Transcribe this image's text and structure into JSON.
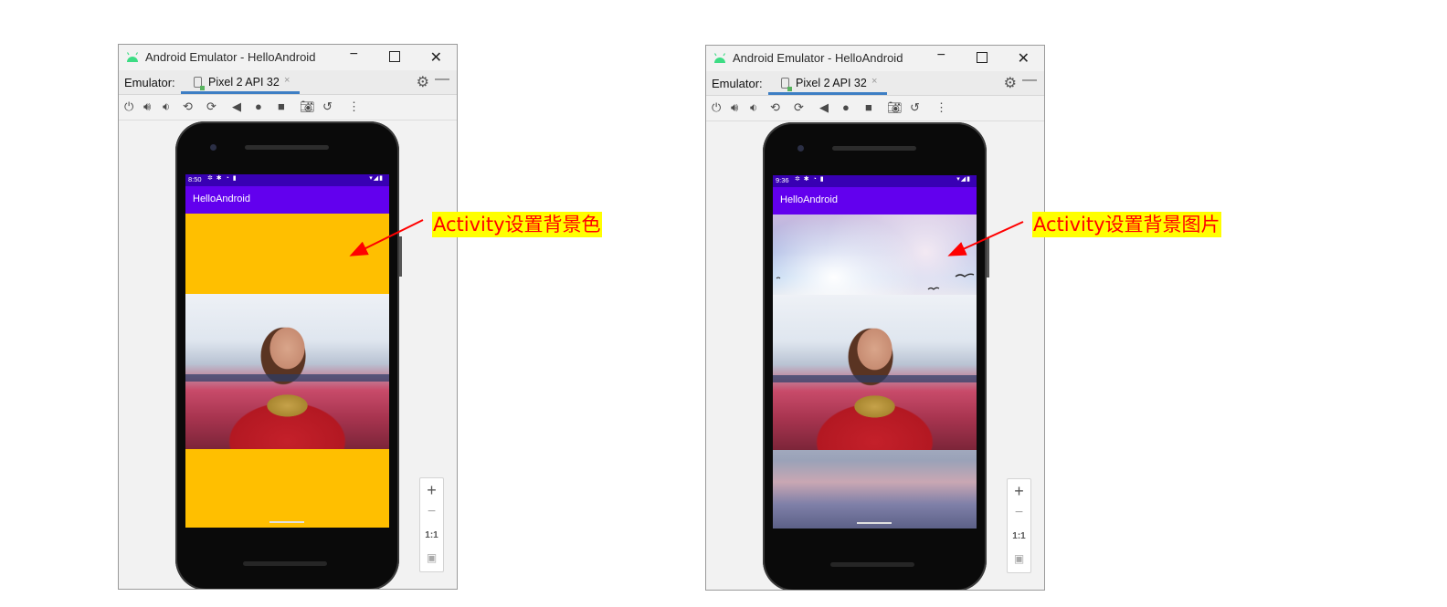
{
  "windows": [
    {
      "title": "Android Emulator - HelloAndroid",
      "tab_label": "Emulator:",
      "tab_name": "Pixel 2 API 32",
      "status_time": "8:50",
      "app_title": "HelloAndroid",
      "background_type": "color",
      "background_color": "#ffbf00"
    },
    {
      "title": "Android Emulator - HelloAndroid",
      "tab_label": "Emulator:",
      "tab_name": "Pixel 2 API 32",
      "status_time": "9:36",
      "app_title": "HelloAndroid",
      "background_type": "image"
    }
  ],
  "window_controls": {
    "minimize": "−",
    "close": "✕"
  },
  "tab_close": "×",
  "toolbar_icons": [
    "power-icon",
    "volume-up-icon",
    "volume-down-icon",
    "rotate-left-icon",
    "rotate-right-icon",
    "back-icon",
    "home-icon",
    "overview-icon",
    "screenshot-icon",
    "snapshot-icon",
    "more-icon"
  ],
  "zoom_panel": {
    "zoom_in": "+",
    "zoom_out": "−",
    "actual_size": "1:1"
  },
  "annotations": {
    "left": "Activity设置背景色",
    "right": "Activity设置背景图片"
  },
  "colors": {
    "arrow": "#ff0000",
    "highlight": "#ffff00",
    "appbar": "#6200ee",
    "statusbar": "#3800b3",
    "tab_underline": "#3d7ec4"
  }
}
